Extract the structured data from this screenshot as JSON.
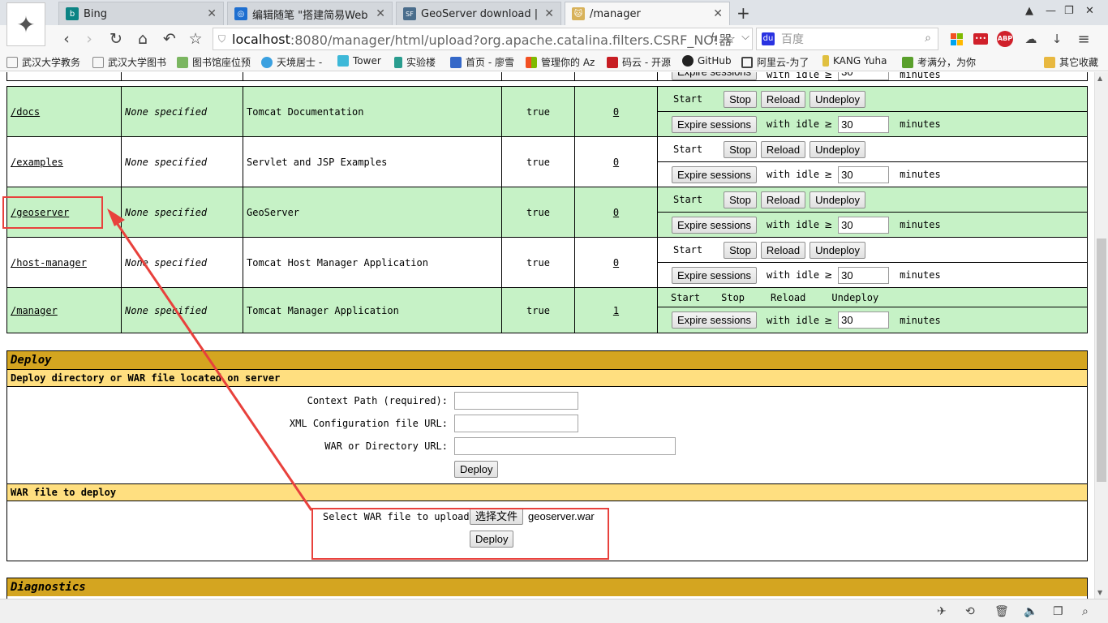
{
  "tabs": [
    {
      "title": "Bing",
      "fav_color": "#0c8484",
      "fav_glyph": "b"
    },
    {
      "title": "编辑随笔 \"搭建简易Web GI",
      "fav_color": "#1e6fd0",
      "fav_glyph": "◎"
    },
    {
      "title": "GeoServer download | So",
      "fav_color": "#4a6d8c",
      "fav_glyph": "SF"
    },
    {
      "title": "/manager",
      "fav_color": "#d8b25a",
      "fav_glyph": "🐱"
    }
  ],
  "nav": {
    "url_host": "localhost",
    "url_rest": ":8080/manager/html/upload?org.apache.catalina.filters.CSRF_NO!器",
    "search_placeholder": "百度",
    "back_icon": "chevron-left-icon",
    "forward_icon": "chevron-right-icon",
    "reload_icon": "reload-icon",
    "home_icon": "home-icon",
    "undo_icon": "undo-icon",
    "star_icon": "star-icon"
  },
  "bookmarks": [
    {
      "label": "武汉大学教务",
      "color": "#888"
    },
    {
      "label": "武汉大学图书",
      "color": "#888"
    },
    {
      "label": "图书馆座位预",
      "color": "#7bb661"
    },
    {
      "label": "天境居士 -",
      "color": "#3aa0e0"
    },
    {
      "label": "Tower",
      "color": "#3db8d8"
    },
    {
      "label": "实验楼",
      "color": "#2a9d8f"
    },
    {
      "label": "首页 - 廖雪",
      "color": "#3568c8"
    },
    {
      "label": "管理你的 Az",
      "color": "#f25022"
    },
    {
      "label": "码云 - 开源",
      "color": "#c71d23"
    },
    {
      "label": "GitHub",
      "color": "#222"
    },
    {
      "label": "阿里云-为了",
      "color": "#444"
    },
    {
      "label": "KANG Yuha",
      "color": "#e0c040"
    },
    {
      "label": "考满分，为你",
      "color": "#5aa02c"
    },
    {
      "label": "其它收藏",
      "color": "#e8b840"
    }
  ],
  "apps": [
    {
      "path": "/docs",
      "version": "None specified",
      "display": "Tomcat Documentation",
      "running": "true",
      "sessions": "0",
      "row": "green"
    },
    {
      "path": "/examples",
      "version": "None specified",
      "display": "Servlet and JSP Examples",
      "running": "true",
      "sessions": "0",
      "row": "white"
    },
    {
      "path": "/geoserver",
      "version": "None specified",
      "display": "GeoServer",
      "running": "true",
      "sessions": "0",
      "row": "green"
    },
    {
      "path": "/host-manager",
      "version": "None specified",
      "display": "Tomcat Host Manager Application",
      "running": "true",
      "sessions": "0",
      "row": "white"
    },
    {
      "path": "/manager",
      "version": "None specified",
      "display": "Tomcat Manager Application",
      "running": "true",
      "sessions": "1",
      "row": "green"
    }
  ],
  "commands": {
    "start": "Start",
    "stop": "Stop",
    "reload": "Reload",
    "undeploy": "Undeploy",
    "expire": "Expire sessions",
    "with_idle": "with idle",
    "ge": "≥",
    "idle_value": "30",
    "minutes": "minutes"
  },
  "deploy": {
    "title": "Deploy",
    "server_sub": "Deploy directory or WAR file located on server",
    "context_label": "Context Path (required):",
    "xml_label": "XML Configuration file URL:",
    "war_dir_label": "WAR or Directory URL:",
    "deploy_btn": "Deploy",
    "war_sub": "WAR file to deploy",
    "select_label": "Select WAR file to upload",
    "choose_btn": "选择文件",
    "chosen_file": "geoserver.war",
    "deploy_btn2": "Deploy"
  },
  "diagnostics": {
    "title": "Diagnostics"
  }
}
